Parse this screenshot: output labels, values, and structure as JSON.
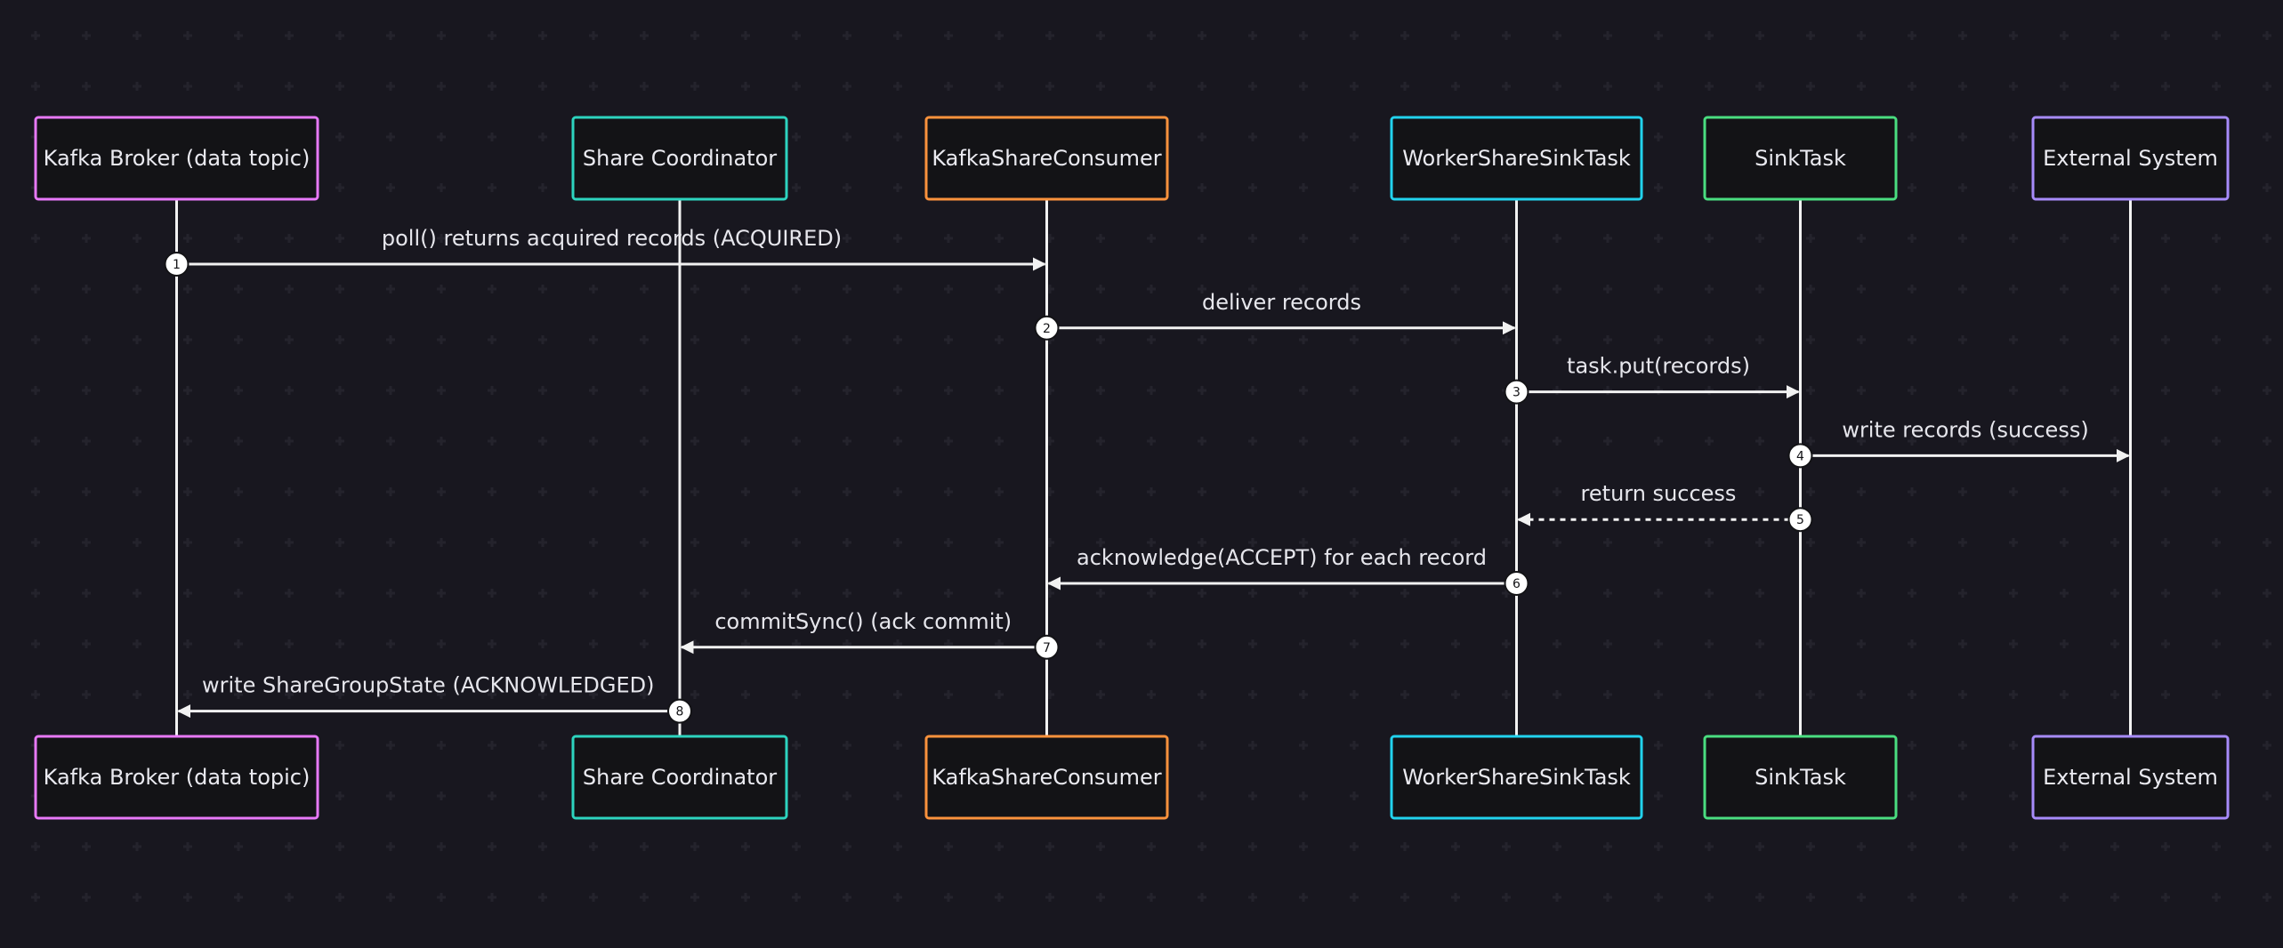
{
  "colors": {
    "background": "#18171f",
    "line": "#f2f2f2",
    "box_fill": "#131316",
    "text": "#eaeaf0"
  },
  "participants": [
    {
      "id": "broker",
      "label": "Kafka Broker (data topic)",
      "color": "#e879f9"
    },
    {
      "id": "coordinator",
      "label": "Share Coordinator",
      "color": "#2dd4bf"
    },
    {
      "id": "consumer",
      "label": "KafkaShareConsumer",
      "color": "#fb923c"
    },
    {
      "id": "worker",
      "label": "WorkerShareSinkTask",
      "color": "#22d3ee"
    },
    {
      "id": "sinktask",
      "label": "SinkTask",
      "color": "#4ade80"
    },
    {
      "id": "external",
      "label": "External System",
      "color": "#a78bfa"
    }
  ],
  "messages": [
    {
      "step": "1",
      "from": "broker",
      "to": "consumer",
      "label": "poll() returns acquired records (ACQUIRED)",
      "style": "solid"
    },
    {
      "step": "2",
      "from": "consumer",
      "to": "worker",
      "label": "deliver records",
      "style": "solid"
    },
    {
      "step": "3",
      "from": "worker",
      "to": "sinktask",
      "label": "task.put(records)",
      "style": "solid"
    },
    {
      "step": "4",
      "from": "sinktask",
      "to": "external",
      "label": "write records (success)",
      "style": "solid"
    },
    {
      "step": "5",
      "from": "sinktask",
      "to": "worker",
      "label": "return success",
      "style": "dashed"
    },
    {
      "step": "6",
      "from": "worker",
      "to": "consumer",
      "label": "acknowledge(ACCEPT) for each record",
      "style": "solid"
    },
    {
      "step": "7",
      "from": "consumer",
      "to": "coordinator",
      "label": "commitSync() (ack commit)",
      "style": "solid"
    },
    {
      "step": "8",
      "from": "coordinator",
      "to": "broker",
      "label": "write ShareGroupState (ACKNOWLEDGED)",
      "style": "solid"
    }
  ]
}
